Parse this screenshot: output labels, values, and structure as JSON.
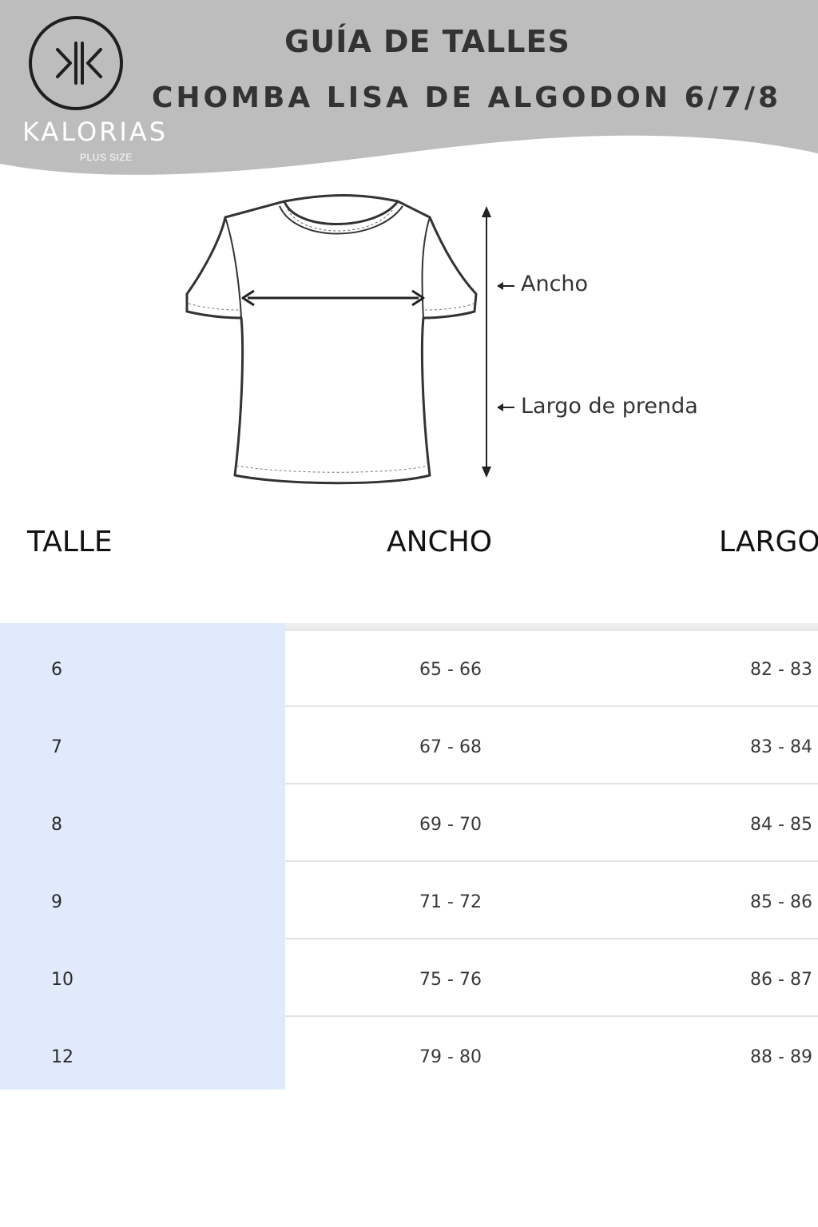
{
  "header": {
    "title": "GUÍA DE TALLES",
    "subtitle": "CHOMBA LISA DE ALGODON 6/7/8",
    "band_color": "#bdbdbd"
  },
  "logo": {
    "brand": "KALORIAS",
    "tagline": "PLUS SIZE"
  },
  "diagram": {
    "label_width": "Ancho",
    "label_length": "Largo de prenda"
  },
  "table": {
    "columns": [
      "TALLE",
      "ANCHO",
      "LARGO"
    ],
    "highlight_color": "#e0eafb",
    "rows": [
      {
        "size": "6",
        "ancho": "65 - 66",
        "largo": "82 - 83"
      },
      {
        "size": "7",
        "ancho": "67 - 68",
        "largo": "83 - 84"
      },
      {
        "size": "8",
        "ancho": "69 - 70",
        "largo": "84 - 85"
      },
      {
        "size": "9",
        "ancho": "71 - 72",
        "largo": "85 - 86"
      },
      {
        "size": "10",
        "ancho": "75 - 76",
        "largo": "86 - 87"
      },
      {
        "size": "12",
        "ancho": "79 - 80",
        "largo": "88 - 89"
      }
    ]
  }
}
